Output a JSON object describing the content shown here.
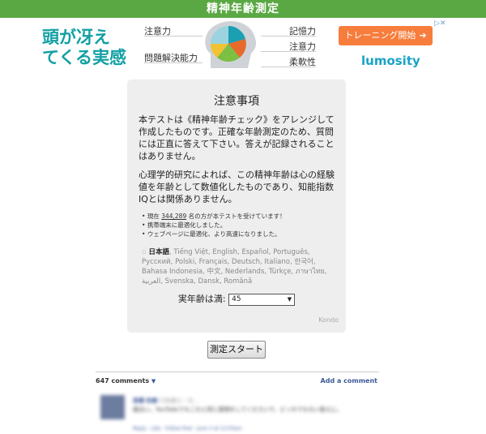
{
  "header": {
    "title": "精神年齢測定"
  },
  "ad": {
    "headline_line1": "頭が冴え",
    "headline_line2": "てくる実感",
    "labels": {
      "left_top": "注意力",
      "left_bottom": "問題解決能力",
      "right_top": "記憶力",
      "right_middle": "注意力",
      "right_bottom": "柔軟性"
    },
    "cta_label": "トレーニング開始",
    "brand": "lumosity",
    "chart_colors": [
      "#1b9fb3",
      "#f1c232",
      "#e86a2b",
      "#7cbf42",
      "#9bd4df"
    ]
  },
  "card": {
    "title": "注意事項",
    "para1": "本テストは《精神年齢チェック》をアレンジして作成したものです。正確な年齢測定のため、質問には正直に答えて下さい。答えが記録されることはありません。",
    "para2": "心理学的研究によれば、この精神年齢は心の経験値を年齢として数値化したものであり、知能指数IQとは関係ありません。",
    "notes": {
      "n1_prefix": "現在 ",
      "n1_count": "344,289",
      "n1_suffix": " 名の方が本テストを受けています！",
      "n2": "携帯端末に最適化しました。",
      "n3": "ウェブページに最適化、より高速になりました。"
    },
    "languages": {
      "current": "日本語",
      "others": ", Tiếng Việt, English, Español, Português, Русский, Polski, Français, Deutsch, Italiano, 한국어, Bahasa Indonesia, 中文, Nederlands, Türkçe, ภาษาไทย, العربية, Svenska, Dansk, Română"
    },
    "age_label": "実年齢は満:",
    "age_value": "45",
    "credit": "Kondo"
  },
  "start_button": "測定スタート",
  "comments": {
    "count_label": "647 comments",
    "add_label": "Add a comment",
    "first": {
      "name": "高橋 和樹",
      "tag": "行政書士・社…",
      "text": "面白い。YouTubeでもこれと同じ質問をしてくださいで、どっちでもない答えに。",
      "footer": "Reply · Like · Follow Post · June 3 at 12:03am"
    }
  }
}
